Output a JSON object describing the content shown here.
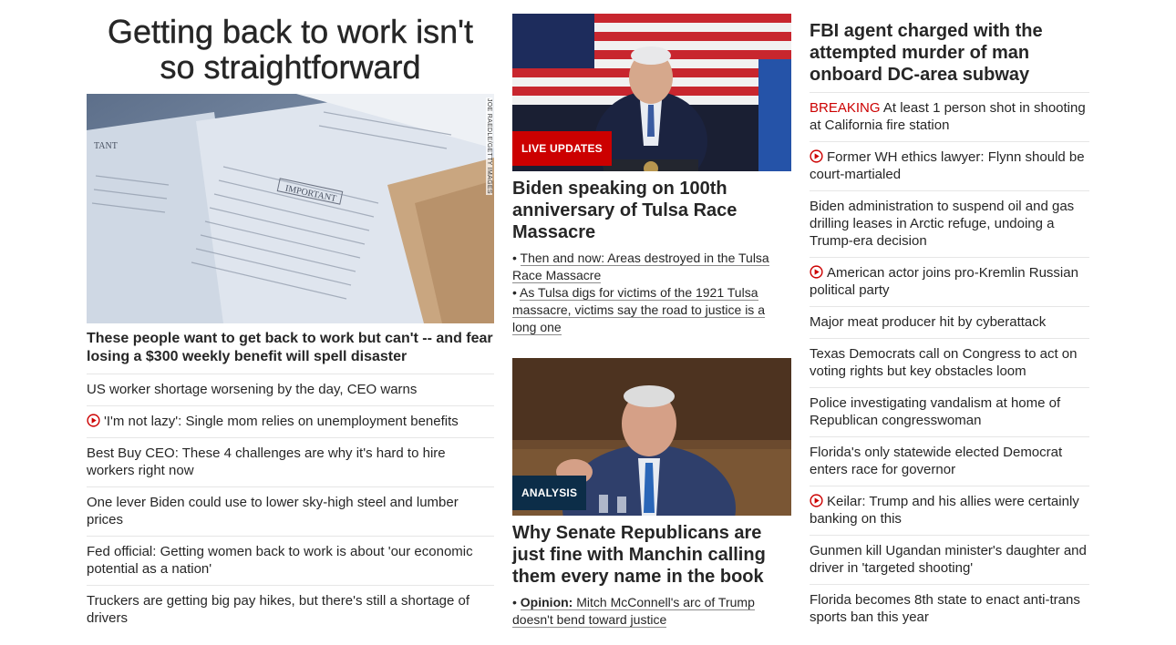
{
  "left": {
    "hero_title": "Getting back to work isn't so straightforward",
    "image_credit": "JOE RAEDLE/GETTY IMAGES",
    "hero_headline": "These people want to get back to work but can't -- and fear losing a $300 weekly benefit will spell disaster",
    "items": [
      {
        "text": "US worker shortage worsening by the day, CEO warns",
        "video": false
      },
      {
        "text": "'I'm not lazy': Single mom relies on unemployment benefits",
        "video": true
      },
      {
        "text": "Best Buy CEO: These 4 challenges are why it's hard to hire workers right now",
        "video": false
      },
      {
        "text": "One lever Biden could use to lower sky-high steel and lumber prices",
        "video": false
      },
      {
        "text": "Fed official: Getting women back to work is about 'our economic potential as a nation'",
        "video": false
      },
      {
        "text": "Truckers are getting big pay hikes, but there's still a shortage of drivers",
        "video": false
      }
    ]
  },
  "mid": {
    "story1": {
      "label": "LIVE UPDATES",
      "headline": "Biden speaking on 100th anniversary of Tulsa Race Massacre",
      "links": [
        "Then and now: Areas destroyed in the Tulsa Race Massacre",
        "As Tulsa digs for victims of the 1921 Tulsa massacre, victims say the road to justice is a long one"
      ]
    },
    "story2": {
      "label": "ANALYSIS",
      "headline": "Why Senate Republicans are just fine with Manchin calling them every name in the book",
      "link_prefix": "Opinion:",
      "link": "Mitch McConnell's arc of Trump doesn't bend toward justice"
    }
  },
  "right": {
    "headline": "FBI agent charged with the attempted murder of man onboard DC-area subway",
    "breaking_label": "BREAKING",
    "items": [
      {
        "text": "At least 1 person shot in shooting at California fire station",
        "video": false,
        "breaking": true
      },
      {
        "text": "Former WH ethics lawyer: Flynn should be court-martialed",
        "video": true,
        "breaking": false
      },
      {
        "text": "Biden administration to suspend oil and gas drilling leases in Arctic refuge, undoing a Trump-era decision",
        "video": false,
        "breaking": false
      },
      {
        "text": "American actor joins pro-Kremlin Russian political party",
        "video": true,
        "breaking": false
      },
      {
        "text": "Major meat producer hit by cyberattack",
        "video": false,
        "breaking": false
      },
      {
        "text": "Texas Democrats call on Congress to act on voting rights but key obstacles loom",
        "video": false,
        "breaking": false
      },
      {
        "text": "Police investigating vandalism at home of Republican congresswoman",
        "video": false,
        "breaking": false
      },
      {
        "text": "Florida's only statewide elected Democrat enters race for governor",
        "video": false,
        "breaking": false
      },
      {
        "text": "Keilar: Trump and his allies were certainly banking on this",
        "video": true,
        "breaking": false
      },
      {
        "text": "Gunmen kill Ugandan minister's daughter and driver in 'targeted shooting'",
        "video": false,
        "breaking": false
      },
      {
        "text": "Florida becomes 8th state to enact anti-trans sports ban this year",
        "video": false,
        "breaking": false
      }
    ]
  },
  "colors": {
    "accent_red": "#cc0000",
    "analysis_navy": "#0c2d48",
    "text": "#262626"
  },
  "icons": {
    "video": "play-circle-icon"
  }
}
